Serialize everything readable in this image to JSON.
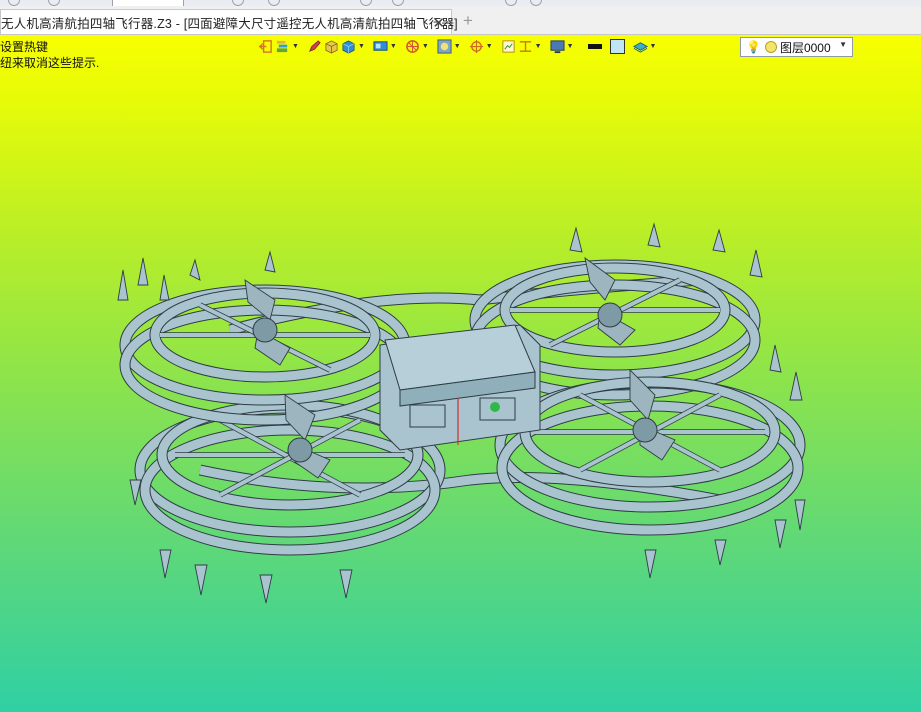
{
  "tab": {
    "title": "无人机高清航拍四轴飞行器.Z3 - [四面避障大尺寸遥控无人机高清航拍四轴飞行器]",
    "close_glyph": "✕",
    "new_tab_glyph": "+"
  },
  "hints": {
    "line1": "设置热键",
    "line2": "纽来取消这些提示."
  },
  "toolbar": {
    "icons": [
      "exit-view-icon",
      "layer-stack-icon",
      "pen-icon",
      "box-shaded-icon",
      "cube-icon",
      "display-mode-icon",
      "section-icon",
      "render-icon",
      "snap-icon",
      "frame-icon",
      "dimension-icon",
      "screen-icon",
      "line-color-swatch",
      "fill-color-swatch",
      "layer-plane-icon"
    ],
    "layer_selector": {
      "bulb_glyph": "💡",
      "value": "图层0000",
      "arrow": "▼"
    }
  },
  "colors": {
    "viewport_top": "#f8ff00",
    "viewport_bottom": "#2fd0a4",
    "model_fill": "#a9c4cf",
    "model_edge": "#2f3d44"
  }
}
